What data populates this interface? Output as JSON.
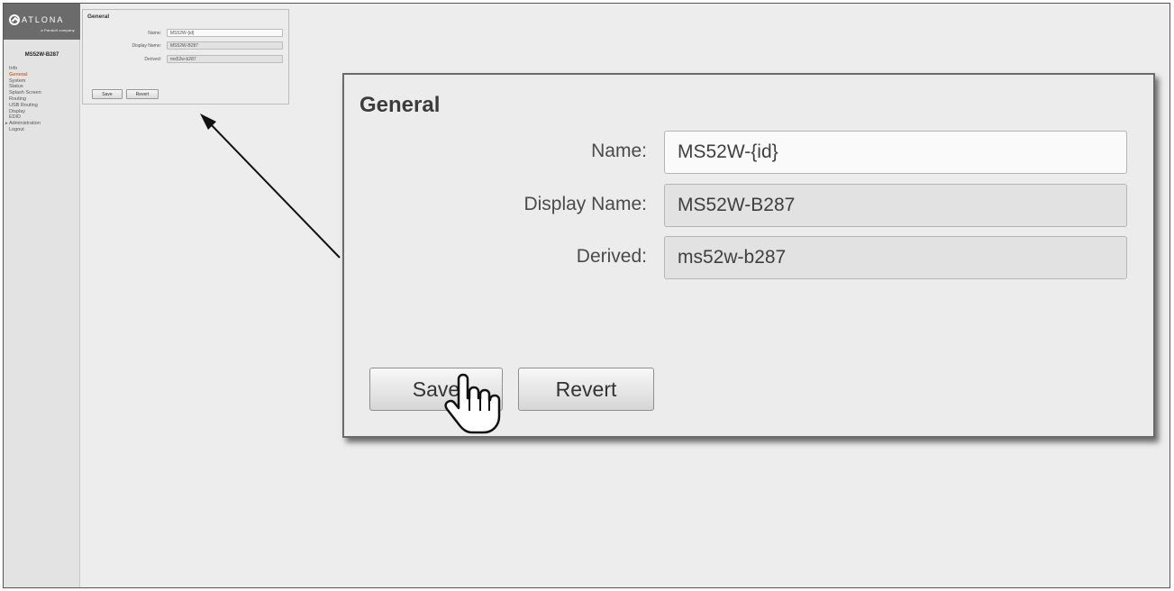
{
  "brand": {
    "logo_text": "ATLONA",
    "logo_sub": "a Panduit company"
  },
  "sidebar": {
    "device_name": "MS52W-B287",
    "items": [
      {
        "label": "Info",
        "active": false
      },
      {
        "label": "General",
        "active": true
      },
      {
        "label": "System",
        "active": false
      },
      {
        "label": "Status",
        "active": false
      },
      {
        "label": "Splash Screen",
        "active": false
      },
      {
        "label": "Routing",
        "active": false
      },
      {
        "label": "USB Routing",
        "active": false
      },
      {
        "label": "Display",
        "active": false
      },
      {
        "label": "EDID",
        "active": false
      },
      {
        "label": "Administration",
        "active": false,
        "expandable": true
      },
      {
        "label": "Logout",
        "active": false
      }
    ]
  },
  "general": {
    "title": "General",
    "fields": [
      {
        "label": "Name:",
        "value": "MS52W-{id}",
        "editable": true
      },
      {
        "label": "Display Name:",
        "value": "MS52W-B287",
        "editable": false
      },
      {
        "label": "Derived:",
        "value": "ms52w-b287",
        "editable": false
      }
    ],
    "save_label": "Save",
    "revert_label": "Revert"
  },
  "colors": {
    "accent": "#e26a1f",
    "logo_bar": "#6b6b6b",
    "panel_bg": "#ececec"
  },
  "icons": {
    "cursor": "hand-pointer-icon",
    "callout_arrow": "arrow-pointer-icon"
  }
}
